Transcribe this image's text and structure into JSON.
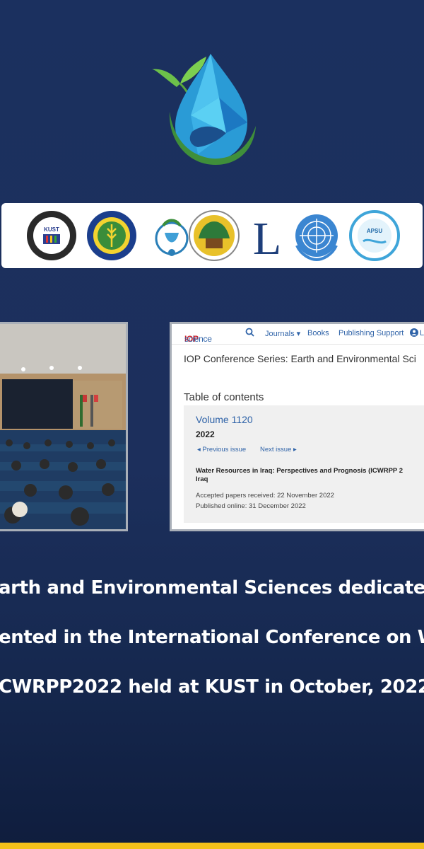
{
  "iop_page": {
    "brand_iop": "IOP",
    "brand_science": "science",
    "nav": {
      "journals": "Journals ▾",
      "books": "Books",
      "publishing_support": "Publishing Support",
      "login": "Lo"
    },
    "series_title": "IOP Conference Series: Earth and Environmental Sci",
    "toc_heading": "Table of contents",
    "volume": "Volume 1120",
    "year": "2022",
    "previous_issue": "◂ Previous issue",
    "next_issue": "Next issue ▸",
    "conference_title": "Water Resources in Iraq: Perspectives and Prognosis (ICWRPP 2",
    "conference_title_2": "Iraq",
    "accepted": "Accepted papers received: 22 November 2022",
    "published": "Published online: 31 December 2022"
  },
  "partner_logos": {
    "kust_seal_text": "KUST",
    "l_logo_letter": "L"
  },
  "caption": {
    "line1": "arth and Environmental Sciences dedicate",
    "line2": "ented in the International Conference on W",
    "line3": "CWRPP2022 held at KUST in October, 2022"
  },
  "colors": {
    "background": "#1b305f",
    "accent_bar": "#f3c11b",
    "link_blue": "#2f63a8",
    "iop_red": "#d0222a"
  }
}
